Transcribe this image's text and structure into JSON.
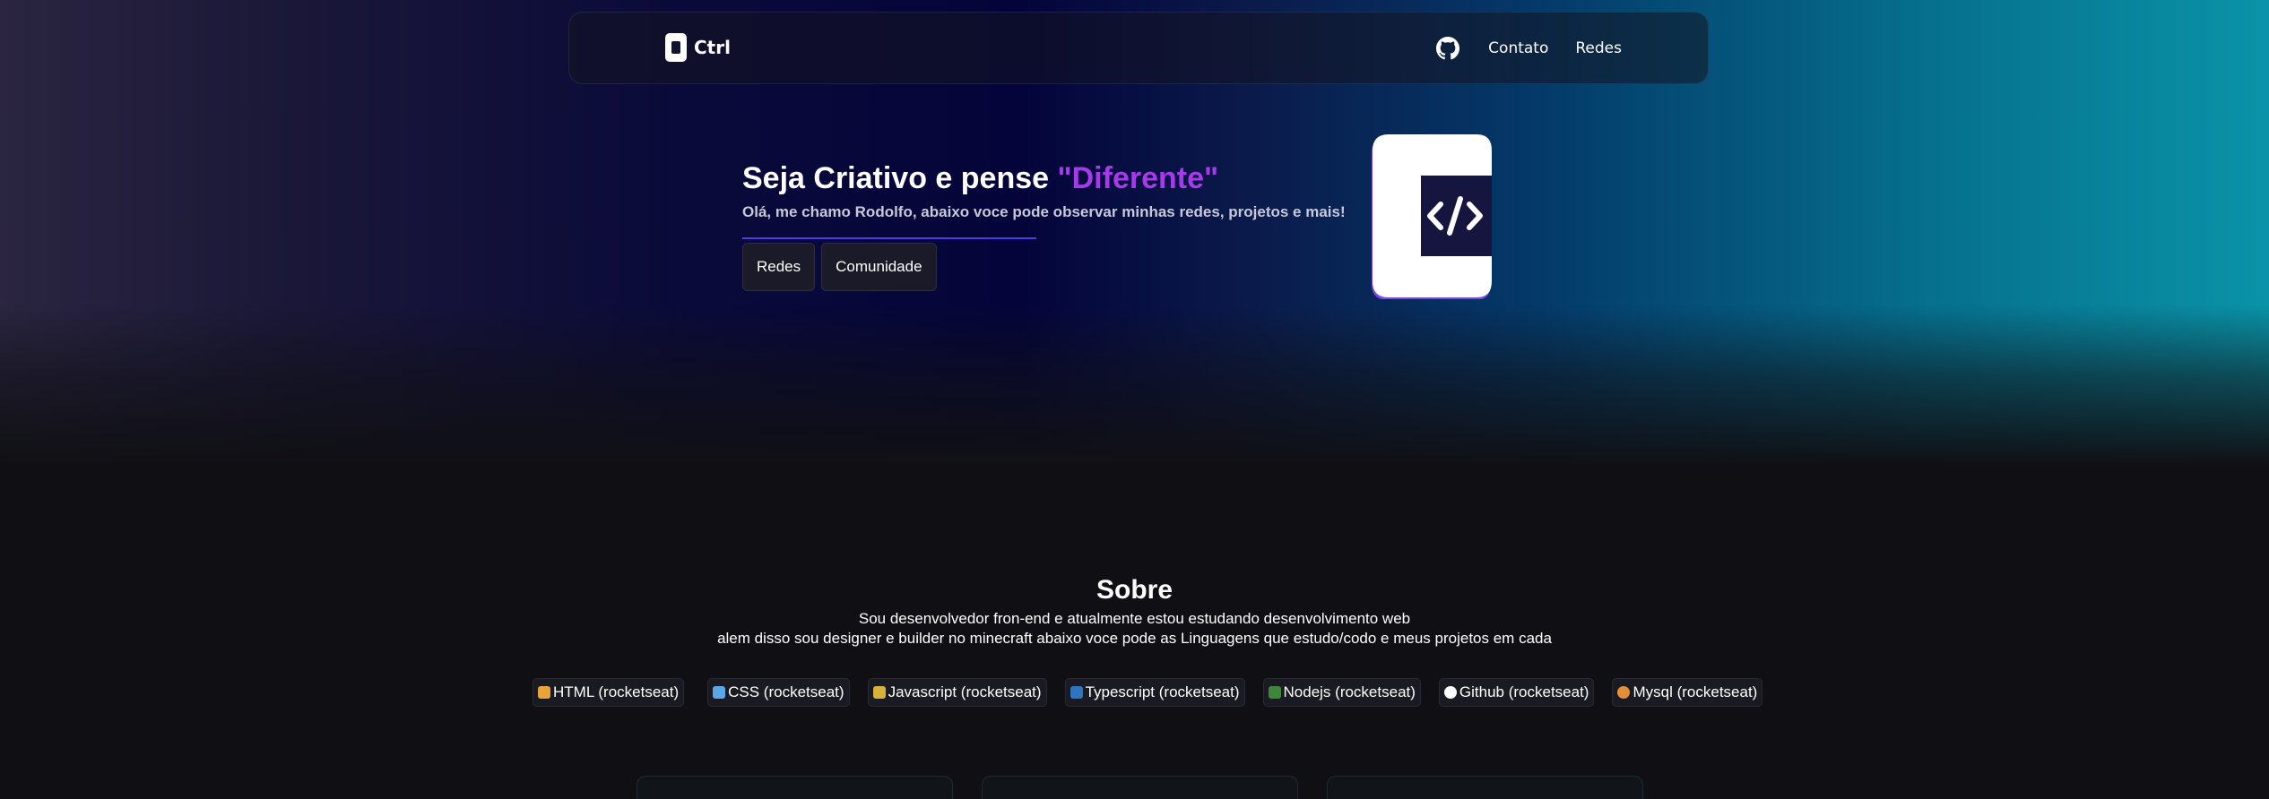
{
  "colors": {
    "accent_purple": "#a63ae8",
    "accent_line": "#4b3ee0",
    "page_bg": "#101014"
  },
  "nav": {
    "brand": "Ctrl",
    "github_icon": "github-icon",
    "links": [
      "Contato",
      "Redes"
    ]
  },
  "hero": {
    "title_main": "Seja Criativo e pense ",
    "title_accent": "\"Diferente\"",
    "subtitle": "Olá, me chamo Rodolfo, abaixo voce pode observar minhas redes, projetos e mais!",
    "buttons": [
      "Redes",
      "Comunidade"
    ],
    "logo_icon": "code-brand-logo-icon"
  },
  "about": {
    "title": "Sobre",
    "line1": "Sou desenvolvedor fron-end e atualmente estou estudando desenvolvimento web",
    "line2": "alem disso sou designer e builder no minecraft abaixo voce pode as Linguagens que estudo/codo e meus projetos em cada"
  },
  "tags": [
    {
      "label": "HTML (rocketseat)",
      "icon": "html-icon",
      "color": "#e8a33a"
    },
    {
      "label": "CSS (rocketseat)",
      "icon": "css-icon",
      "color": "#5aa7e8"
    },
    {
      "label": "Javascript (rocketseat)",
      "icon": "javascript-icon",
      "color": "#d8b03a"
    },
    {
      "label": "Typescript (rocketseat)",
      "icon": "typescript-icon",
      "color": "#2f74c0"
    },
    {
      "label": "Nodejs (rocketseat)",
      "icon": "nodejs-icon",
      "color": "#3c873a"
    },
    {
      "label": "Github (rocketseat)",
      "icon": "github-icon",
      "color": "#ffffff"
    },
    {
      "label": "Mysql (rocketseat)",
      "icon": "mysql-icon",
      "color": "#e48e3a"
    }
  ]
}
